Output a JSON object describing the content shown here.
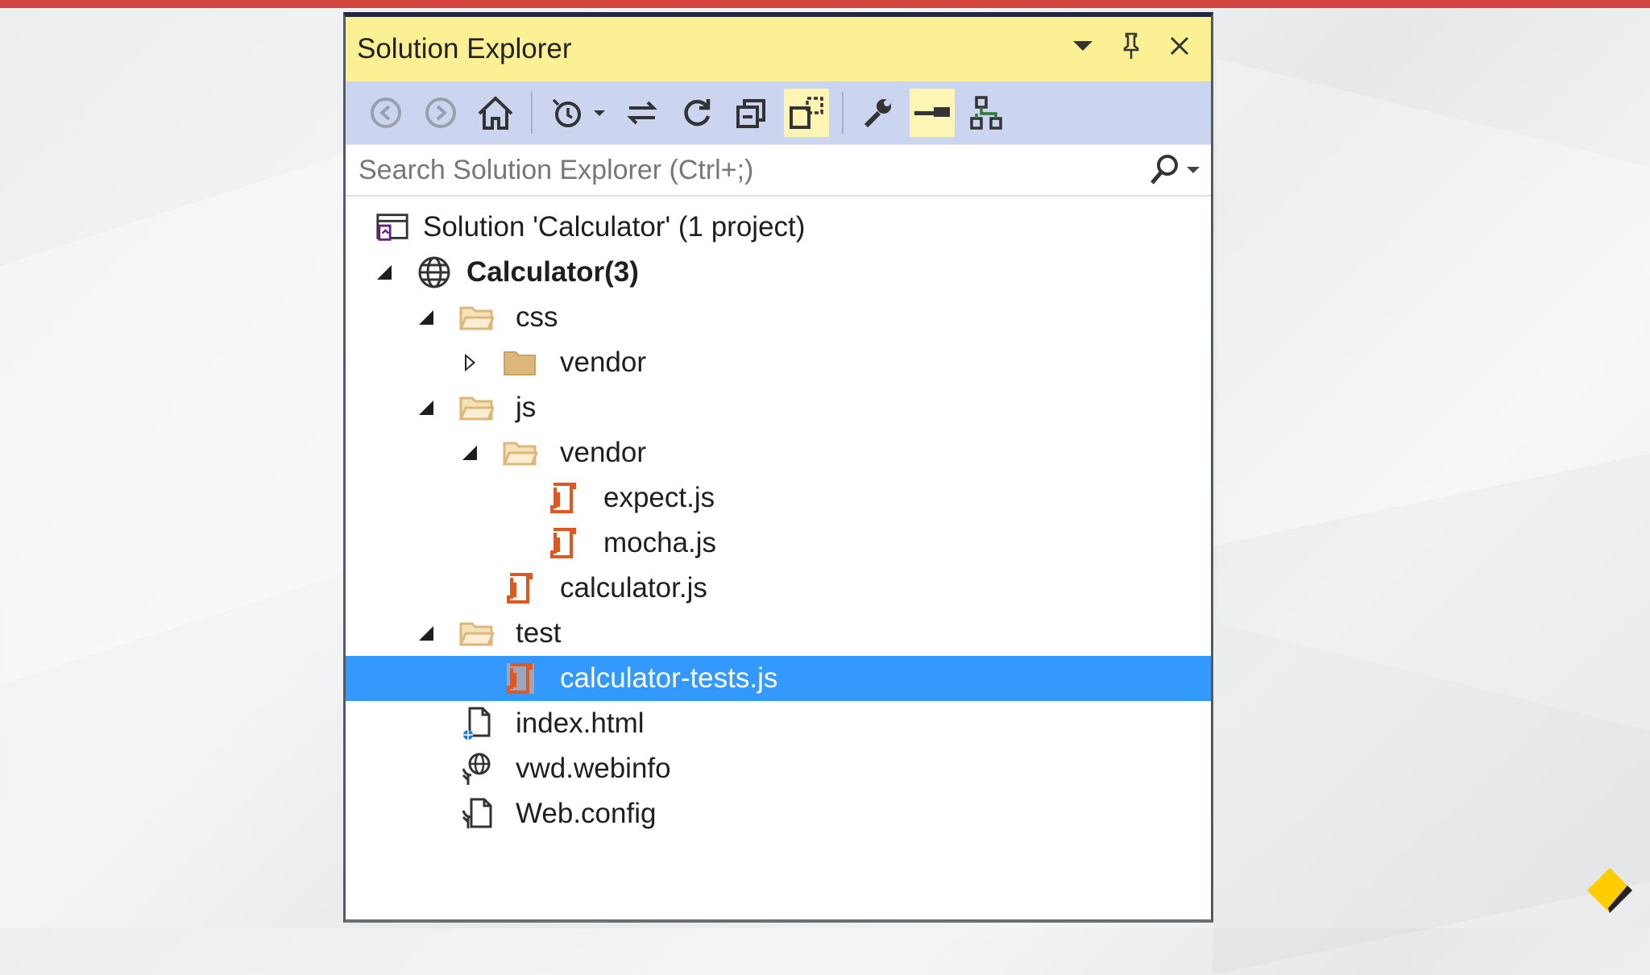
{
  "panel": {
    "title": "Solution Explorer"
  },
  "search": {
    "placeholder": "Search Solution Explorer (Ctrl+;)"
  },
  "tree": {
    "solution": "Solution 'Calculator' (1 project)",
    "project": "Calculator(3)",
    "css_folder": "css",
    "css_vendor_folder": "vendor",
    "js_folder": "js",
    "js_vendor_folder": "vendor",
    "expect_js": "expect.js",
    "mocha_js": "mocha.js",
    "calculator_js": "calculator.js",
    "test_folder": "test",
    "calculator_tests_js": "calculator-tests.js",
    "index_html": "index.html",
    "vwd_webinfo": "vwd.webinfo",
    "web_config": "Web.config"
  },
  "colors": {
    "titlebar": "#fbf093",
    "toolbar": "#ccd5f0",
    "selection": "#3399ff",
    "js_icon": "#e2571e",
    "folder_icon": "#dcb67a",
    "top_bar": "#d4453f"
  },
  "icons": {
    "toolbar": [
      "back-icon",
      "forward-icon",
      "home-icon",
      "pending-changes-filter-icon",
      "sync-icon",
      "refresh-icon",
      "collapse-all-icon",
      "show-all-files-icon",
      "properties-icon",
      "preview-selected-icon",
      "class-view-icon"
    ]
  }
}
